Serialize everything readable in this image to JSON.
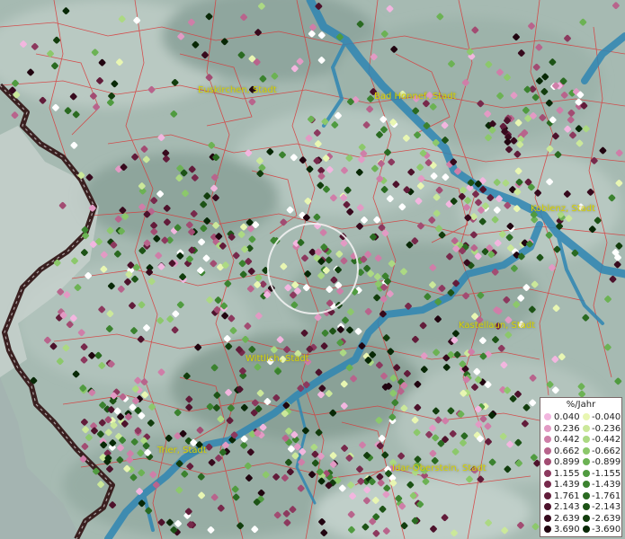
{
  "map": {
    "cities": [
      {
        "name": "Euskirchen, Stadt"
      },
      {
        "name": "Bad Honnef, Stadt"
      },
      {
        "name": "Koblenz, Stadt"
      },
      {
        "name": "Kastellaun, Stadt"
      },
      {
        "name": "Wittlich, Stadt"
      },
      {
        "name": "Trier, Stadt"
      },
      {
        "name": "Idar-Oberstein, Stadt"
      }
    ],
    "colors": {
      "river": "#2f86b3",
      "border": "#3a2020",
      "admin_lines": "#d83a3a",
      "label": "#d8d400"
    }
  },
  "legend": {
    "title": "%/Jahr",
    "positive": [
      {
        "value": "0.040",
        "color": "#f2b6df"
      },
      {
        "value": "0.236",
        "color": "#e29ac4"
      },
      {
        "value": "0.442",
        "color": "#cf7ea8"
      },
      {
        "value": "0.662",
        "color": "#b8648c"
      },
      {
        "value": "0.899",
        "color": "#a24c72"
      },
      {
        "value": "1.155",
        "color": "#8c395e"
      },
      {
        "value": "1.439",
        "color": "#77294b"
      },
      {
        "value": "1.761",
        "color": "#621c3a"
      },
      {
        "value": "2.143",
        "color": "#4d122b"
      },
      {
        "value": "2.639",
        "color": "#370a1d"
      },
      {
        "value": "3.690",
        "color": "#210510"
      }
    ],
    "negative": [
      {
        "value": "-0.040",
        "color": "#e8f6b2"
      },
      {
        "value": "-0.236",
        "color": "#cbe89a"
      },
      {
        "value": "-0.442",
        "color": "#acd983"
      },
      {
        "value": "-0.662",
        "color": "#8cc86b"
      },
      {
        "value": "-0.899",
        "color": "#6cb254"
      },
      {
        "value": "-1.155",
        "color": "#509b40"
      },
      {
        "value": "-1.439",
        "color": "#3b822f"
      },
      {
        "value": "-1.761",
        "color": "#2a6a21"
      },
      {
        "value": "-2.143",
        "color": "#1d5316"
      },
      {
        "value": "-2.639",
        "color": "#123d0d"
      },
      {
        "value": "-3.690",
        "color": "#082806"
      }
    ]
  }
}
